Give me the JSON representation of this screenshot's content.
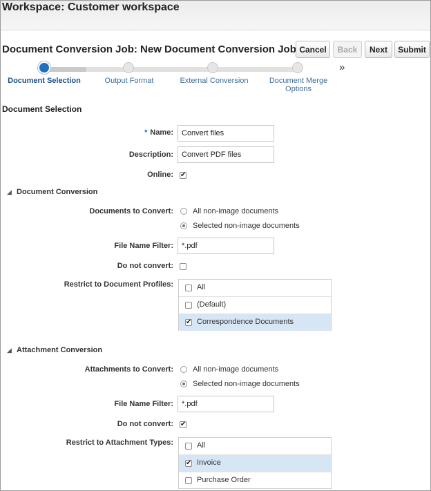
{
  "workspace_title": "Workspace: Customer workspace",
  "job_title": "Document Conversion Job: New Document Conversion Job",
  "toolbar": {
    "cancel": "Cancel",
    "back": "Back",
    "next": "Next",
    "submit": "Submit"
  },
  "train": {
    "stops": [
      {
        "label": "Document Selection",
        "current": true
      },
      {
        "label": "Output Format",
        "current": false
      },
      {
        "label": "External Conversion",
        "current": false
      },
      {
        "label": "Document Merge Options",
        "current": false
      }
    ],
    "more_icon": "double-chevron-right"
  },
  "section_title": "Document Selection",
  "form": {
    "name_label": "Name:",
    "name_value": "Convert files",
    "description_label": "Description:",
    "description_value": "Convert PDF files",
    "online_label": "Online:",
    "online_checked": true
  },
  "doc_conversion": {
    "title": "Document Conversion",
    "to_convert_label": "Documents to Convert:",
    "options": [
      "All non-image documents",
      "Selected non-image documents"
    ],
    "selected_option": 1,
    "filter_label": "File Name Filter:",
    "filter_value": "*.pdf",
    "do_not_convert_label": "Do not convert:",
    "do_not_convert_checked": false,
    "restrict_label": "Restrict to Document Profiles:",
    "profiles": [
      {
        "label": "All",
        "checked": false
      },
      {
        "label": "(Default)",
        "checked": false
      },
      {
        "label": "Correspondence Documents",
        "checked": true
      }
    ]
  },
  "att_conversion": {
    "title": "Attachment Conversion",
    "to_convert_label": "Attachments to Convert:",
    "options": [
      "All non-image documents",
      "Selected non-image documents"
    ],
    "selected_option": 1,
    "filter_label": "File Name Filter:",
    "filter_value": "*.pdf",
    "do_not_convert_label": "Do not convert:",
    "do_not_convert_checked": true,
    "restrict_label": "Restrict to Attachment Types:",
    "types": [
      {
        "label": "All",
        "checked": false
      },
      {
        "label": "Invoice",
        "checked": true
      },
      {
        "label": "Purchase Order",
        "checked": false
      }
    ]
  },
  "colors": {
    "accent": "#1f6fbf",
    "link": "#3c6d9c",
    "selection": "#d6e6f5"
  }
}
